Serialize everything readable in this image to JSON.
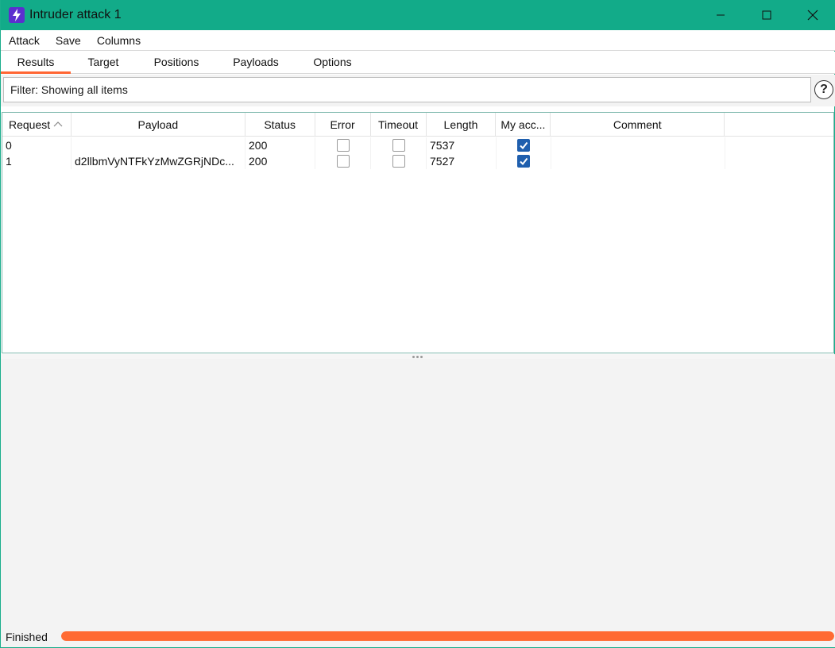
{
  "window": {
    "title": "Intruder attack 1",
    "accent_color": "#12ab89",
    "controls": [
      "minimize-icon",
      "maximize-icon",
      "close-icon"
    ]
  },
  "menu": {
    "items": [
      "Attack",
      "Save",
      "Columns"
    ]
  },
  "tabs": [
    {
      "label": "Results",
      "active": true
    },
    {
      "label": "Target",
      "active": false
    },
    {
      "label": "Positions",
      "active": false
    },
    {
      "label": "Payloads",
      "active": false
    },
    {
      "label": "Options",
      "active": false
    }
  ],
  "filter": {
    "text": "Filter: Showing all items",
    "help_icon": "?"
  },
  "table": {
    "columns": [
      "Request",
      "Payload",
      "Status",
      "Error",
      "Timeout",
      "Length",
      "My acc...",
      "Comment",
      ""
    ],
    "sort_column": "Request",
    "sort_direction": "ascending",
    "rows": [
      {
        "request": "0",
        "payload": "",
        "status": "200",
        "error": false,
        "timeout": false,
        "length": "7537",
        "my_acc": true,
        "comment": ""
      },
      {
        "request": "1",
        "payload": "d2llbmVyNTFkYzMwZGRjNDc...",
        "status": "200",
        "error": false,
        "timeout": false,
        "length": "7527",
        "my_acc": true,
        "comment": ""
      }
    ]
  },
  "status": {
    "text": "Finished",
    "progress": 1.0,
    "progress_color": "#ff6a33"
  }
}
